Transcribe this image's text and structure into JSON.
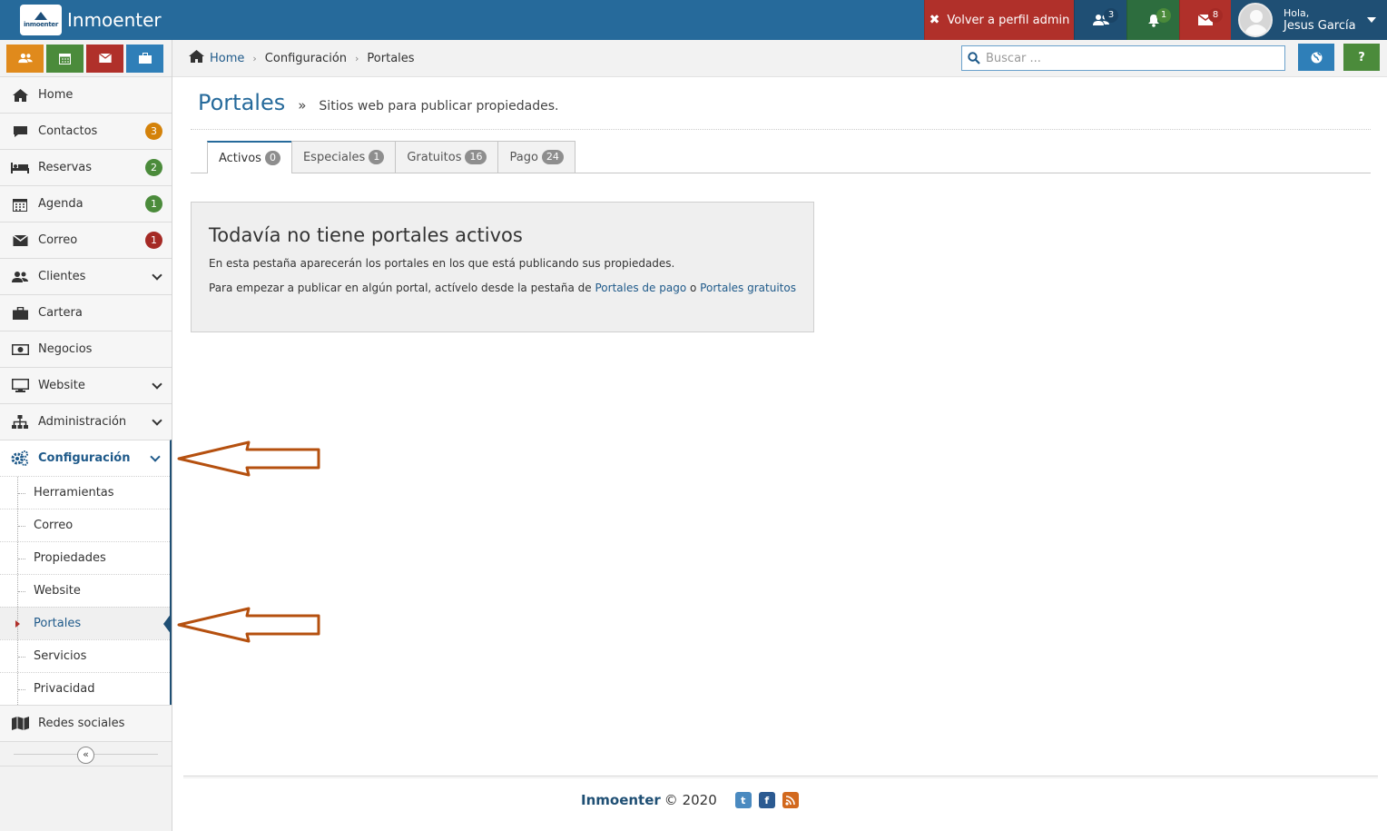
{
  "topbar": {
    "brand_logo_text": "inmoenter",
    "brand_name": "Inmoenter",
    "admin_button": "Volver a perfil admin",
    "users_count": "3",
    "notifications_count": "1",
    "messages_count": "8",
    "greeting": "Hola,",
    "user_name": "Jesus García"
  },
  "sidebar": {
    "items": [
      {
        "label": "Home",
        "icon": "home-icon"
      },
      {
        "label": "Contactos",
        "icon": "chat-icon",
        "badge": "3",
        "badge_color": "#d4820a"
      },
      {
        "label": "Reservas",
        "icon": "bed-icon",
        "badge": "2",
        "badge_color": "#4b8b3b"
      },
      {
        "label": "Agenda",
        "icon": "calendar-icon",
        "badge": "1",
        "badge_color": "#4b8b3b"
      },
      {
        "label": "Correo",
        "icon": "envelope-icon",
        "badge": "1",
        "badge_color": "#a52a25"
      },
      {
        "label": "Clientes",
        "icon": "users-icon"
      },
      {
        "label": "Cartera",
        "icon": "briefcase-icon"
      },
      {
        "label": "Negocios",
        "icon": "money-icon"
      },
      {
        "label": "Website",
        "icon": "monitor-icon"
      },
      {
        "label": "Administración",
        "icon": "sitemap-icon"
      },
      {
        "label": "Configuración",
        "icon": "gears-icon"
      }
    ],
    "submenu": [
      "Herramientas",
      "Correo",
      "Propiedades",
      "Website",
      "Portales",
      "Servicios",
      "Privacidad"
    ],
    "redes": "Redes sociales"
  },
  "breadcrumb": {
    "home": "Home",
    "section": "Configuración",
    "current": "Portales"
  },
  "search": {
    "placeholder": "Buscar ..."
  },
  "page": {
    "title": "Portales",
    "raquo": "»",
    "subtitle": "Sitios web para publicar propiedades."
  },
  "tabs": [
    {
      "label": "Activos",
      "count": "0"
    },
    {
      "label": "Especiales",
      "count": "1"
    },
    {
      "label": "Gratuitos",
      "count": "16"
    },
    {
      "label": "Pago",
      "count": "24"
    }
  ],
  "alert": {
    "title": "Todavía no tiene portales activos",
    "line1": "En esta pestaña aparecerán los portales en los que está publicando sus propiedades.",
    "line2_prefix": "Para empezar a publicar en algún portal, actívelo desde la pestaña de",
    "link_pago": "Portales de pago",
    "line2_mid": "o",
    "link_gratuitos": "Portales gratuitos"
  },
  "footer": {
    "brand": "Inmoenter",
    "copy": "© 2020"
  },
  "colors": {
    "primary": "#266a9b",
    "annotation_arrow": "#b5500f"
  }
}
